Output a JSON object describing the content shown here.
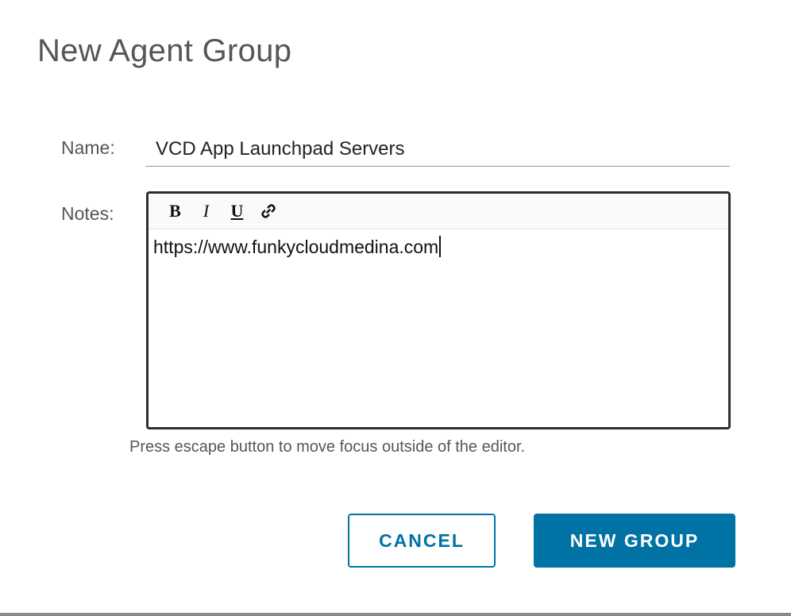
{
  "dialog": {
    "title": "New Agent Group"
  },
  "form": {
    "name_label": "Name:",
    "name_value": "VCD App Launchpad Servers",
    "notes_label": "Notes:",
    "notes_value": "https://www.funkycloudmedina.com",
    "hint": "Press escape button to move focus outside of the editor."
  },
  "toolbar": {
    "bold_label": "B",
    "italic_label": "I",
    "underline_label": "U",
    "link_icon": "link-icon"
  },
  "actions": {
    "cancel_label": "CANCEL",
    "submit_label": "NEW GROUP"
  },
  "colors": {
    "primary": "#0072a3",
    "text": "#565656",
    "editor_border": "#2e2e2e"
  }
}
